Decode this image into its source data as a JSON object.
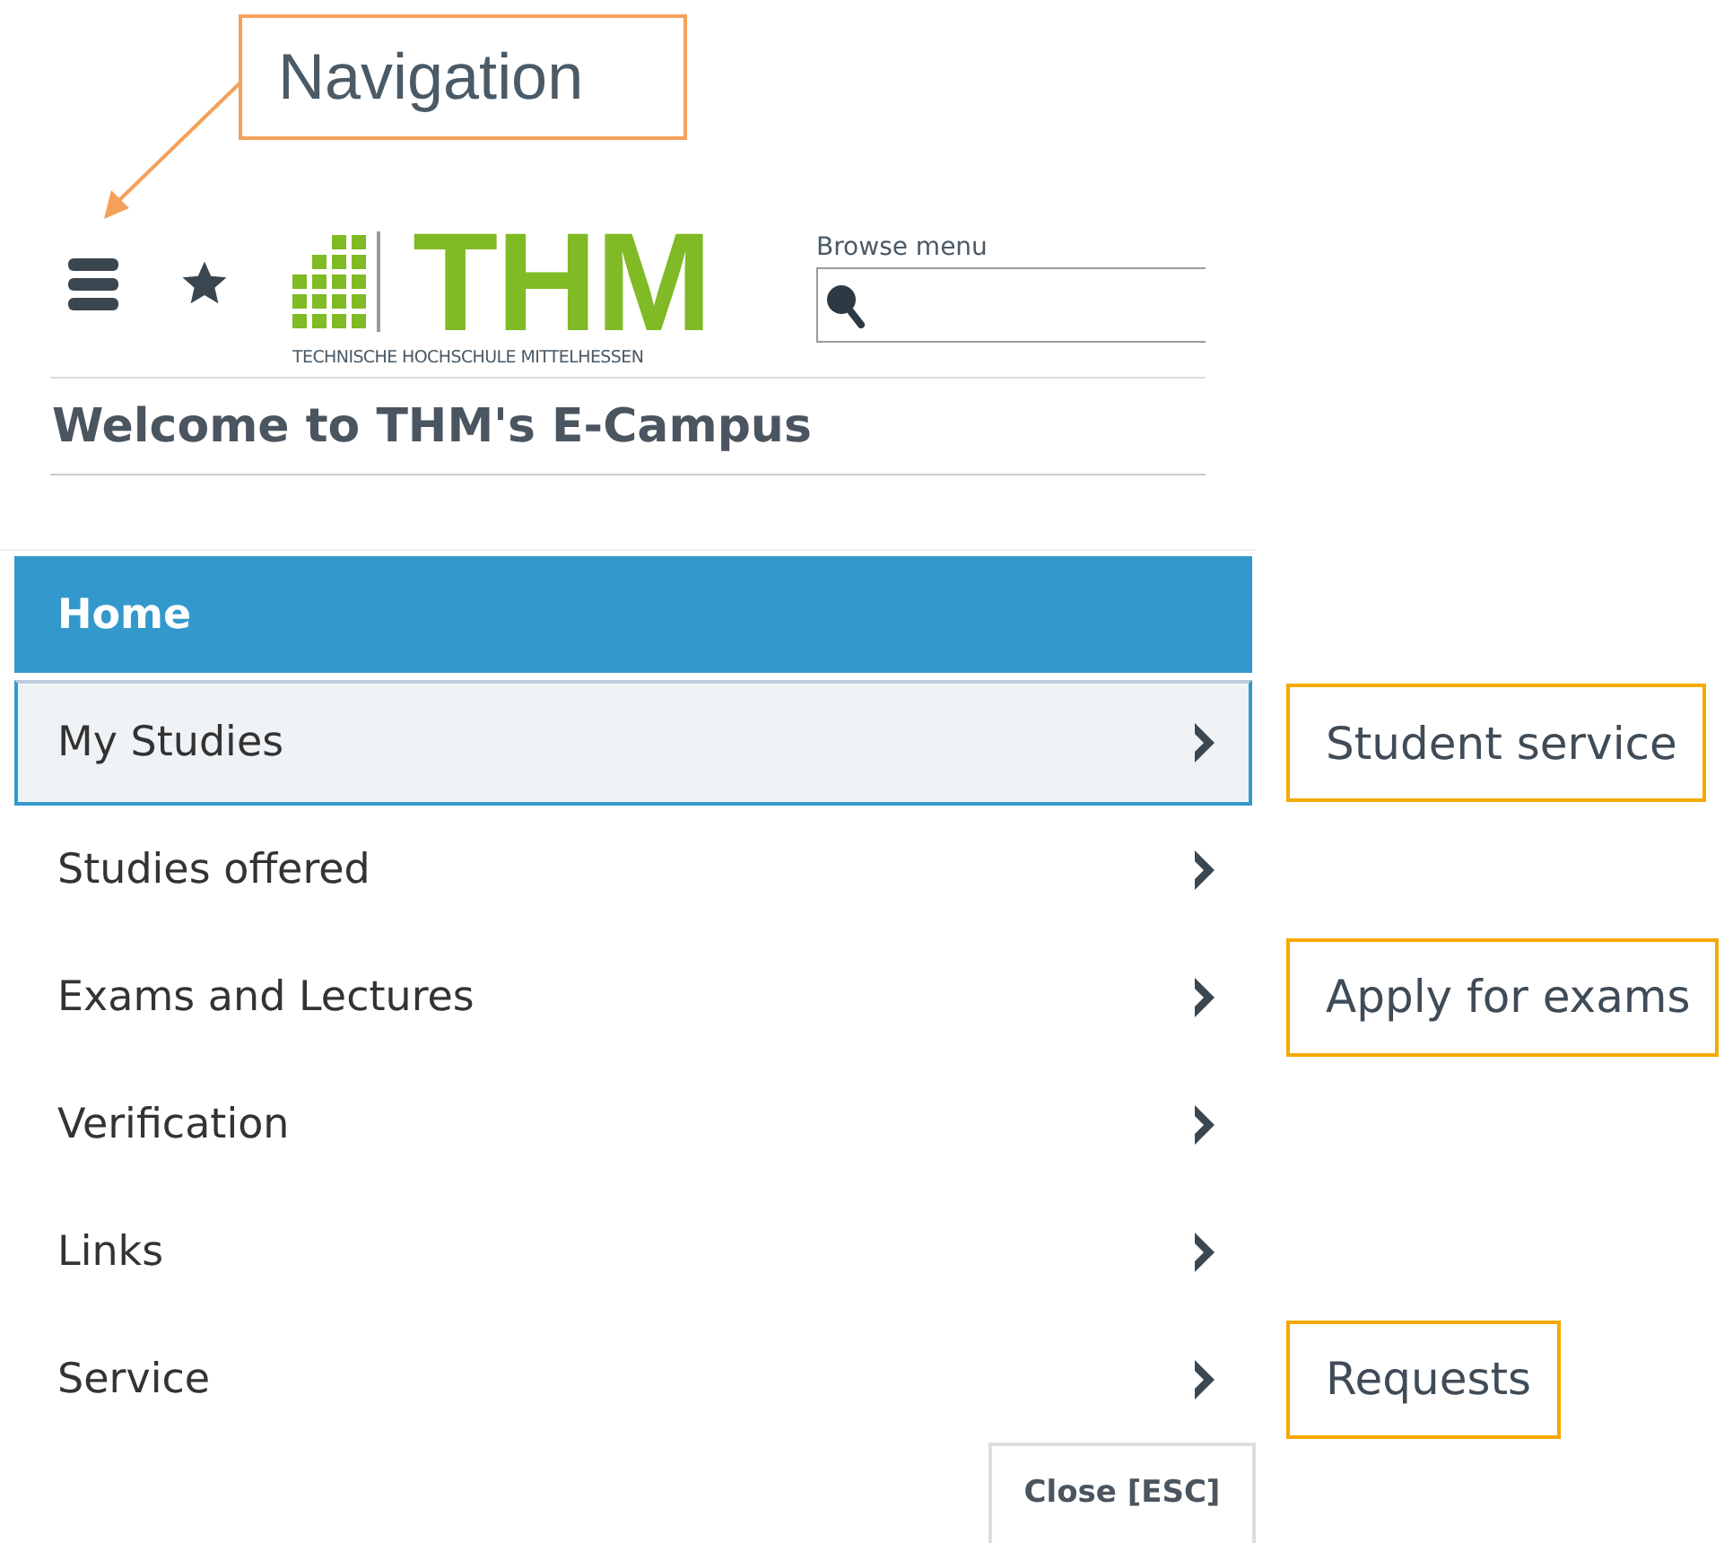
{
  "callout": {
    "text": "Navigation"
  },
  "header": {
    "logo": {
      "wordmark": "THM",
      "subtitle": "TECHNISCHE HOCHSCHULE MITTELHESSEN"
    },
    "search": {
      "label": "Browse menu"
    }
  },
  "page_title": "Welcome to THM's E-Campus",
  "menu": {
    "items": [
      {
        "label": "Home",
        "kind": "heading",
        "selected": true,
        "hovered": false
      },
      {
        "label": "My Studies",
        "kind": "submenu",
        "selected": false,
        "hovered": true,
        "note": "Student service"
      },
      {
        "label": "Studies offered",
        "kind": "submenu",
        "selected": false,
        "hovered": false
      },
      {
        "label": "Exams and Lectures",
        "kind": "submenu",
        "selected": false,
        "hovered": false,
        "note": "Apply for exams"
      },
      {
        "label": "Verification",
        "kind": "submenu",
        "selected": false,
        "hovered": false
      },
      {
        "label": "Links",
        "kind": "submenu",
        "selected": false,
        "hovered": false
      },
      {
        "label": "Service",
        "kind": "submenu",
        "selected": false,
        "hovered": false,
        "note": "Requests"
      }
    ]
  },
  "close_button": "Close [ESC]"
}
